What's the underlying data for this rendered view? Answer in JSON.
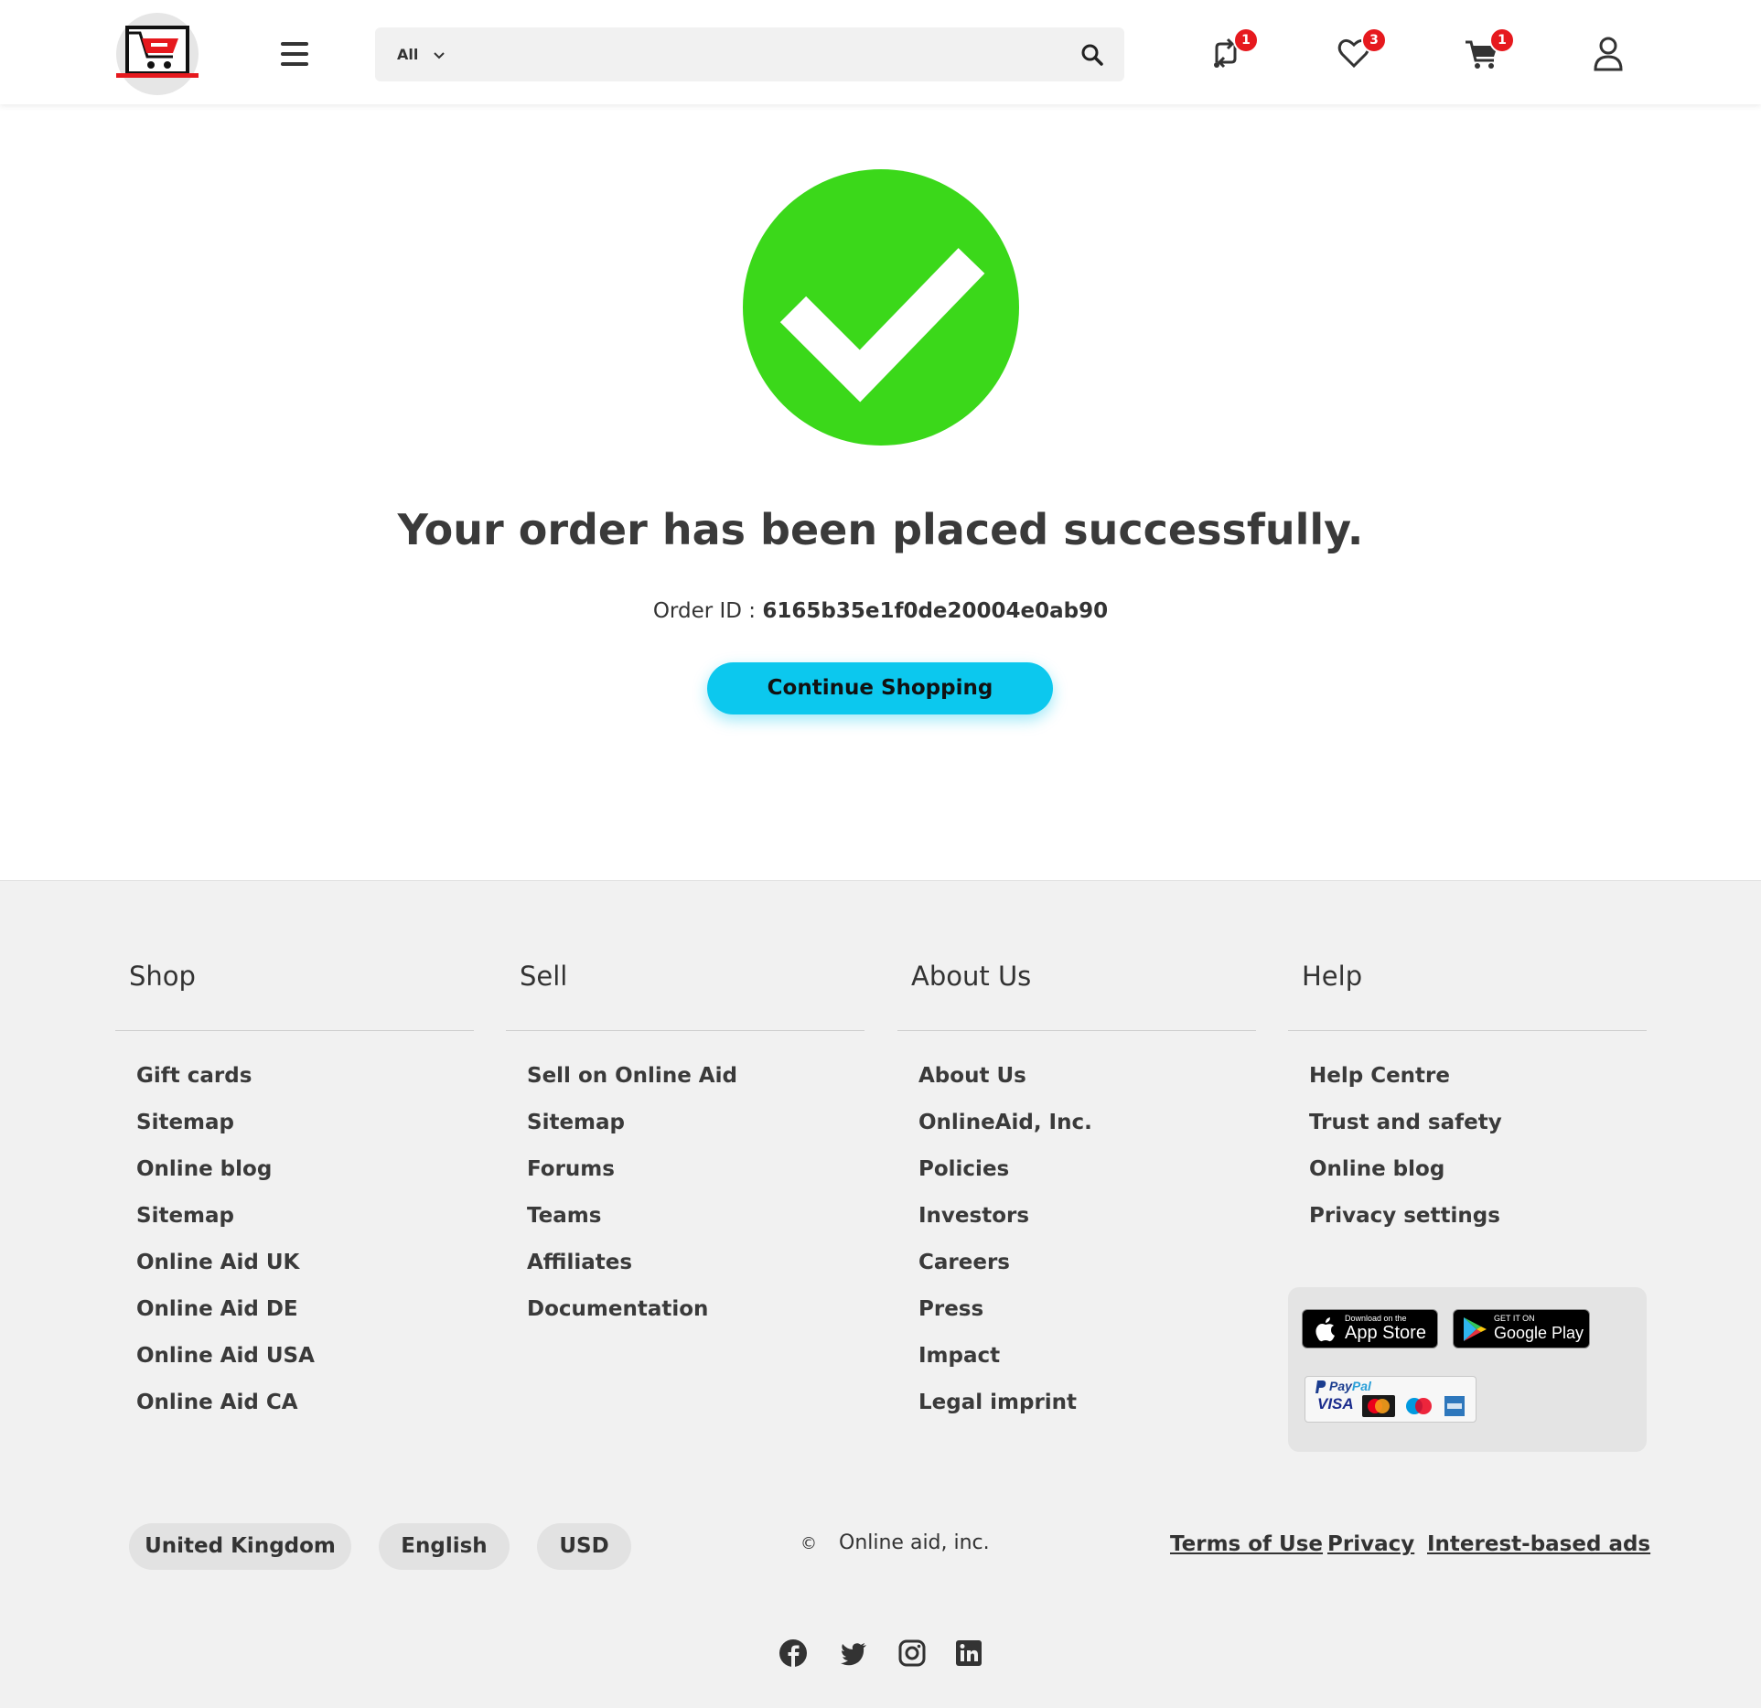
{
  "header": {
    "search_category": "All",
    "search_placeholder": "",
    "badges": {
      "compare": "1",
      "wishlist": "3",
      "cart": "1"
    }
  },
  "main": {
    "title": "Your order has been placed successfully.",
    "order_label": "Order ID : ",
    "order_id": "6165b35e1f0de20004e0ab90",
    "continue_button": "Continue Shopping"
  },
  "footer": {
    "columns": [
      {
        "title": "Shop",
        "items": [
          "Gift cards",
          "Sitemap",
          "Online blog",
          "Sitemap",
          "Online Aid UK",
          "Online Aid DE",
          "Online Aid USA",
          "Online Aid CA"
        ]
      },
      {
        "title": "Sell",
        "items": [
          "Sell on Online Aid",
          "Sitemap",
          "Forums",
          "Teams",
          "Affiliates",
          "Documentation"
        ]
      },
      {
        "title": "About Us",
        "items": [
          "About Us",
          "OnlineAid, Inc.",
          "Policies",
          "Investors",
          "Careers",
          "Press",
          "Impact",
          "Legal imprint"
        ]
      },
      {
        "title": "Help",
        "items": [
          "Help Centre",
          "Trust and safety",
          "Online blog",
          "Privacy settings"
        ]
      }
    ],
    "app_store": {
      "small": "Download on the",
      "big": "App Store"
    },
    "google_play": {
      "small": "GET IT ON",
      "big": "Google Play"
    },
    "payments": {
      "paypal_a": "Pay",
      "paypal_b": "Pal",
      "visa": "VISA"
    },
    "region": "United Kingdom",
    "language": "English",
    "currency": "USD",
    "copyright_symbol": "©",
    "copyright": "Online aid, inc.",
    "legal_links": [
      "Terms of Use",
      "Privacy",
      "Interest-based ads"
    ]
  },
  "colors": {
    "success": "#3bd81a",
    "accent": "#0cc8ee",
    "badge": "#e6191e"
  }
}
